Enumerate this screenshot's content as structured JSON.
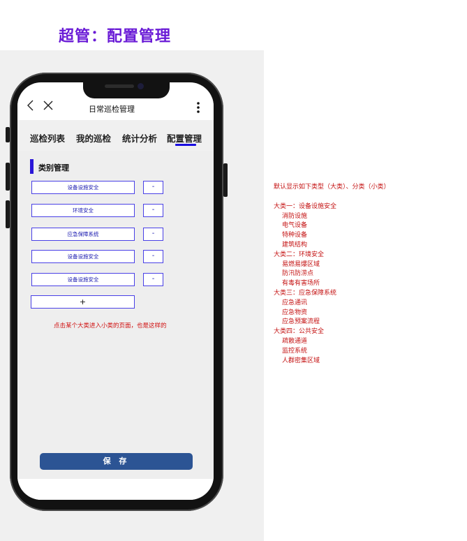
{
  "page_title": "超管：配置管理",
  "app": {
    "title": "日常巡检管理",
    "tabs": [
      {
        "label": "巡检列表",
        "active": false
      },
      {
        "label": "我的巡检",
        "active": false
      },
      {
        "label": "统计分析",
        "active": false
      },
      {
        "label": "配置管理",
        "active": true
      }
    ],
    "section_title": "类别管理",
    "categories": [
      {
        "label": "设备设施安全",
        "remove": "-"
      },
      {
        "label": "环境安全",
        "remove": "-"
      },
      {
        "label": "应急保障系统",
        "remove": "-"
      },
      {
        "label": "设备设施安全",
        "remove": "-"
      },
      {
        "label": "设备设施安全",
        "remove": "-"
      }
    ],
    "add_label": "+",
    "hint": "点击某个大类进入小类的页面，也是这样的",
    "save_label": "保 存"
  },
  "notes": {
    "intro": "默认显示如下类型（大类）、分类（小类）",
    "lines": [
      {
        "text": "大类一：设备设施安全",
        "level": 0
      },
      {
        "text": "消防设施",
        "level": 1
      },
      {
        "text": "电气设备",
        "level": 1
      },
      {
        "text": "特种设备",
        "level": 1
      },
      {
        "text": "建筑结构",
        "level": 1
      },
      {
        "text": "大类二：环境安全",
        "level": 0
      },
      {
        "text": "易燃易爆区域",
        "level": 1
      },
      {
        "text": "防汛防涝点",
        "level": 1
      },
      {
        "text": "有毒有害场所",
        "level": 1
      },
      {
        "text": "大类三：应急保障系统",
        "level": 0
      },
      {
        "text": "应急通讯",
        "level": 1
      },
      {
        "text": "应急物资",
        "level": 1
      },
      {
        "text": "应急预案流程",
        "level": 1
      },
      {
        "text": "大类四：公共安全",
        "level": 0
      },
      {
        "text": "疏散通道",
        "level": 1
      },
      {
        "text": "监控系统",
        "level": 1
      },
      {
        "text": "人群密集区域",
        "level": 1
      }
    ]
  },
  "colors": {
    "title": "#6a1bd6",
    "accent": "#1a0de0",
    "save_button": "#2c5494",
    "note_text": "#c41212"
  },
  "icons": [
    "back-icon",
    "close-icon",
    "more-icon"
  ]
}
